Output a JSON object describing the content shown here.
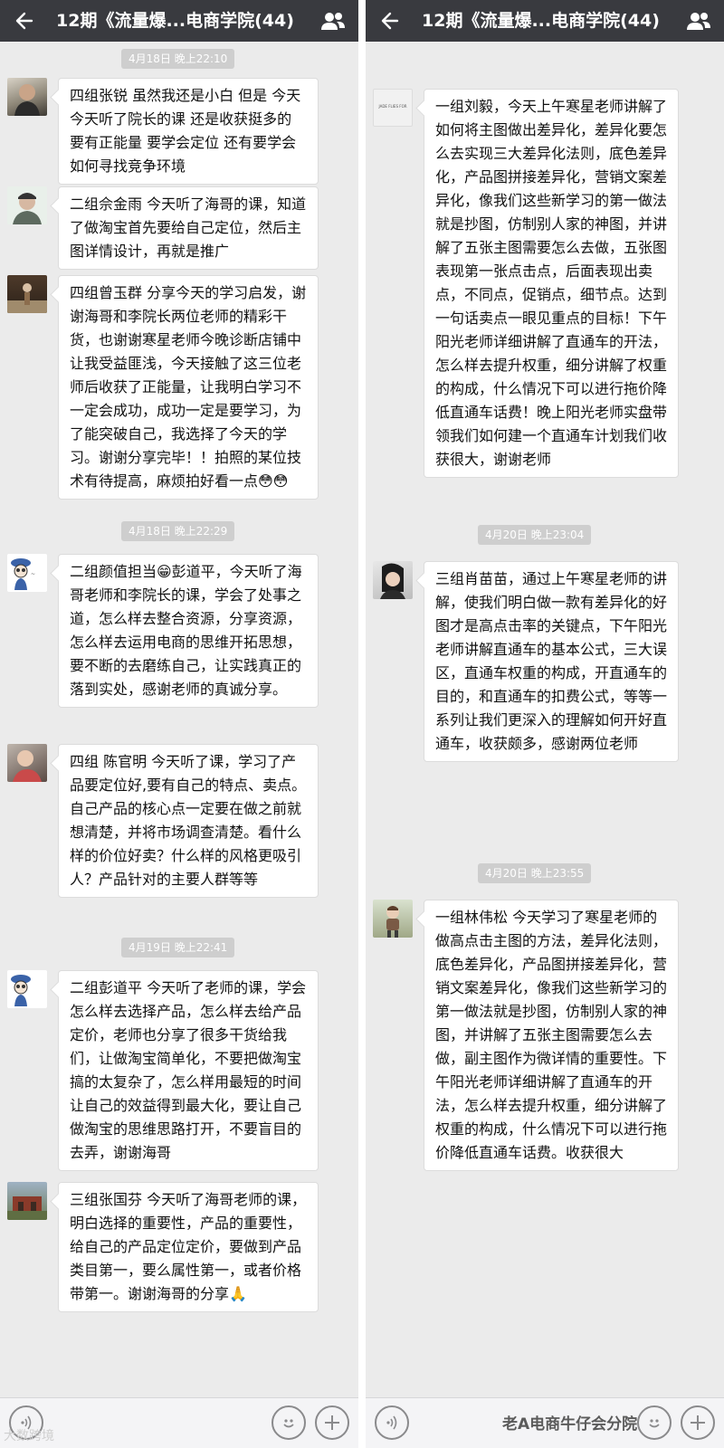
{
  "colors": {
    "header_bg": "#393a3f",
    "chat_bg": "#ebebeb",
    "bubble_bg": "#ffffff",
    "timestamp_bg": "#cecece",
    "input_bar_bg": "#f4f4f6"
  },
  "icons": {
    "back": "back-arrow-icon",
    "group_members": "group-members-icon",
    "voice": "voice-icon",
    "emoji": "emoji-icon",
    "plus": "plus-icon"
  },
  "left": {
    "header": {
      "title": "12期《流量爆...电商学院(44)"
    },
    "timestamps": [
      "4月18日 晚上22:10",
      "4月18日 晚上22:29",
      "4月19日 晚上22:41"
    ],
    "messages": [
      {
        "text": "四组张锐  虽然我还是小白      但是  今天今天听了院长的课  还是收获挺多的  要有正能量  要学会定位  还有要学会如何寻找竞争环境"
      },
      {
        "text": "二组佘金雨  今天听了海哥的课，知道了做淘宝首先要给自己定位，然后主图详情设计，再就是推广"
      },
      {
        "text": "四组曾玉群  分享今天的学习启发，谢谢海哥和李院长两位老师的精彩干货，也谢谢寒星老师今晚诊断店铺中让我受益匪浅，今天接触了这三位老师后收获了正能量，让我明白学习不一定会成功，成功一定是要学习，为了能突破自己，我选择了今天的学习。谢谢分享完毕！！拍照的某位技术有待提高，麻烦拍好看一点😳😳"
      },
      {
        "text": "二组颜值担当😁彭道平，今天听了海哥老师和李院长的课，学会了处事之道，怎么样去整合资源，分享资源，怎么样去运用电商的思维开拓思想，要不断的去磨练自己，让实践真正的落到实处，感谢老师的真诚分享。"
      },
      {
        "text": "四组  陈官明  今天听了课，学习了产品要定位好,要有自己的特点、卖点。自己产品的核心点一定要在做之前就想清楚，并将市场调查清楚。看什么样的价位好卖？什么样的风格更吸引人？产品针对的主要人群等等"
      },
      {
        "text": "二组彭道平    今天听了老师的课，学会怎么样去选择产品，怎么样去给产品定价，老师也分享了很多干货给我们，让做淘宝简单化，不要把做淘宝搞的太复杂了，怎么样用最短的时间让自己的效益得到最大化，要让自己做淘宝的思维思路打开，不要盲目的去弄，谢谢海哥"
      },
      {
        "text": "三组张国芬    今天听了海哥老师的课，明白选择的重要性，产品的重要性，给自己的产品定位定价，要做到产品类目第一，要么属性第一，或者价格带第一。谢谢海哥的分享🙏"
      }
    ],
    "watermark": "大数跨境"
  },
  "right": {
    "header": {
      "title": "12期《流量爆...电商学院(44)"
    },
    "timestamps": [
      "4月20日 晚上23:04",
      "4月20日 晚上23:55"
    ],
    "avatar_caption": "JADE FLIES FOR",
    "messages": [
      {
        "text": "一组刘毅，今天上午寒星老师讲解了如何将主图做出差异化，差异化要怎么去实现三大差异化法则，底色差异化，产品图拼接差异化，营销文案差异化，像我们这些新学习的第一做法就是抄图，仿制别人家的神图，并讲解了五张主图需要怎么去做，五张图表现第一张点击点，后面表现出卖点，不同点，促销点，细节点。达到一句话卖点一眼见重点的目标！下午阳光老师详细讲解了直通车的开法，怎么样去提升权重，细分讲解了权重的构成，什么情况下可以进行拖价降低直通车话费！晚上阳光老师实盘带领我们如何建一个直通车计划我们收获很大，谢谢老师"
      },
      {
        "text": "三组肖苗苗，通过上午寒星老师的讲解，使我们明白做一款有差异化的好图才是高点击率的关键点，下午阳光老师讲解直通车的基本公式，三大误区，直通车权重的构成，开直通车的目的，和直通车的扣费公式，等等一系列让我们更深入的理解如何开好直通车，收获颇多，感谢两位老师"
      },
      {
        "text": "一组林伟松 今天学习了寒星老师的做高点击主图的方法，差异化法则，底色差异化，产品图拼接差异化，营销文案差异化，像我们这些新学习的第一做法就是抄图，仿制别人家的神图，并讲解了五张主图需要怎么去做，副主图作为微详情的重要性。下午阳光老师详细讲解了直通车的开法，怎么样去提升权重，细分讲解了权重的构成，什么情况下可以进行拖价降低直通车话费。收获很大"
      }
    ],
    "watermark": "老A电商牛仔会分院"
  }
}
